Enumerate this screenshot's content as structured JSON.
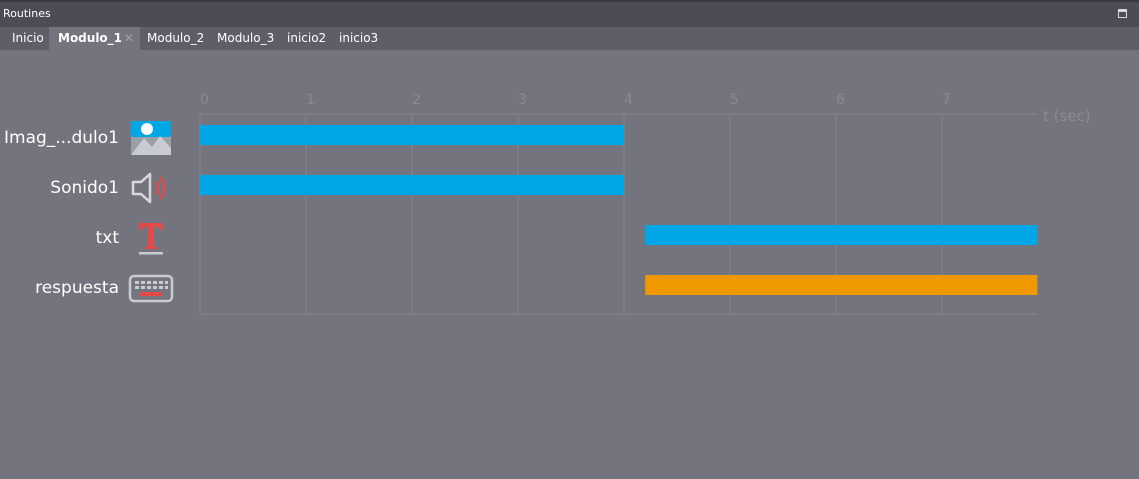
{
  "panel": {
    "title": "Routines"
  },
  "tabs": [
    {
      "label": "Inicio",
      "active": false
    },
    {
      "label": "Modulo_1",
      "active": true
    },
    {
      "label": "Modulo_2",
      "active": false
    },
    {
      "label": "Modulo_3",
      "active": false
    },
    {
      "label": "inicio2",
      "active": false
    },
    {
      "label": "inicio3",
      "active": false
    }
  ],
  "timeline": {
    "axis_label": "t (sec)",
    "ticks": [
      "0",
      "1",
      "2",
      "3",
      "4",
      "5",
      "6",
      "7"
    ],
    "x_max": 7.9,
    "components": [
      {
        "name": "Imag_...dulo1",
        "icon": "image-icon",
        "start": 0,
        "end": 4,
        "color": "#00a7e7"
      },
      {
        "name": "Sonido1",
        "icon": "speaker-icon",
        "start": 0,
        "end": 4,
        "color": "#00a7e7"
      },
      {
        "name": "txt",
        "icon": "text-icon",
        "start": 4.2,
        "end": 7.9,
        "color": "#00a7e7"
      },
      {
        "name": "respuesta",
        "icon": "keyboard-icon",
        "start": 4.2,
        "end": 7.9,
        "color": "#f09800"
      }
    ]
  }
}
